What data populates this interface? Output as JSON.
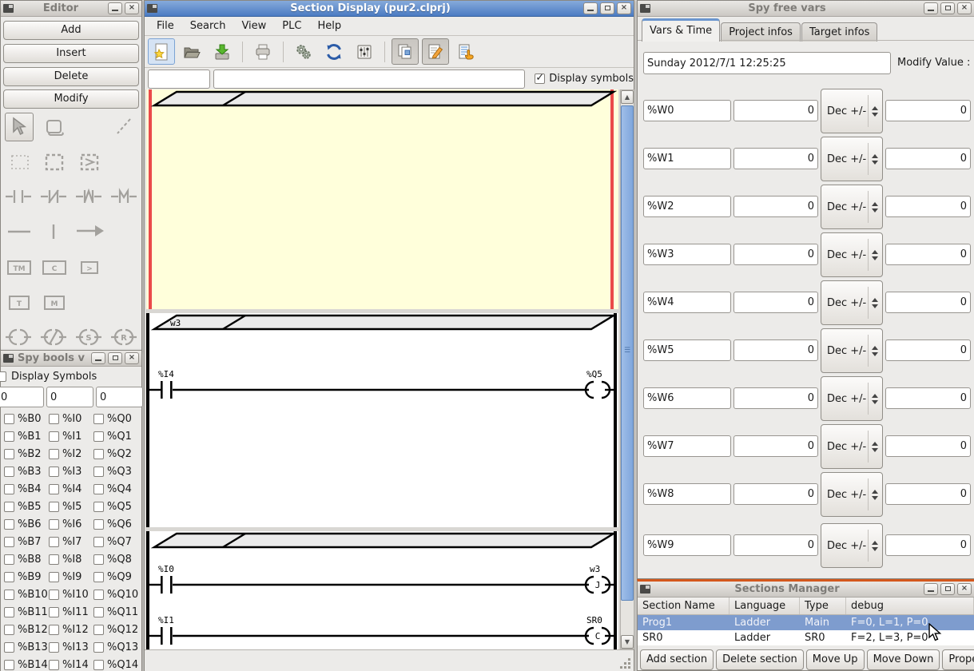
{
  "editor": {
    "title": "Editor",
    "buttons": [
      "Add",
      "Insert",
      "Delete",
      "Modify"
    ],
    "glyphs": {
      "tm": "TM",
      "c": "C",
      "gt": ">",
      "t": "T",
      "m": "M",
      "s": "S",
      "r": "R"
    }
  },
  "section_display": {
    "title": "Section Display (pur2.clprj)",
    "menus": [
      "File",
      "Search",
      "View",
      "PLC",
      "Help"
    ],
    "search_value": "",
    "comment_value": "",
    "display_symbols_label": "Display symbols",
    "ladder": {
      "rung2_label": "w3",
      "net1": {
        "contact": "%I4",
        "coil": "%Q5",
        "coil_letter": ""
      },
      "net2": {
        "contact": "%I0",
        "coil": "w3",
        "coil_letter": "J"
      },
      "net3": {
        "contact": "%I1",
        "coil": "SR0",
        "coil_letter": "C"
      }
    }
  },
  "spy_free_vars": {
    "title": "Spy free vars",
    "tabs": [
      "Vars & Time",
      "Project infos",
      "Target infos"
    ],
    "datetime": "Sunday 2012/7/1 12:25:25",
    "modify_value_label": "Modify Value :",
    "mode_label": "Dec +/-",
    "rows": [
      {
        "name": "%W0",
        "value": "0",
        "modify": "0"
      },
      {
        "name": "%W1",
        "value": "0",
        "modify": "0"
      },
      {
        "name": "%W2",
        "value": "0",
        "modify": "0"
      },
      {
        "name": "%W3",
        "value": "0",
        "modify": "0"
      },
      {
        "name": "%W4",
        "value": "0",
        "modify": "0"
      },
      {
        "name": "%W5",
        "value": "0",
        "modify": "0"
      },
      {
        "name": "%W6",
        "value": "0",
        "modify": "0"
      },
      {
        "name": "%W7",
        "value": "0",
        "modify": "0"
      },
      {
        "name": "%W8",
        "value": "0",
        "modify": "0"
      },
      {
        "name": "%W9",
        "value": "0",
        "modify": "0"
      }
    ]
  },
  "spy_bools": {
    "title": "Spy bools v",
    "display_symbols_label": "Display Symbols",
    "offsets": [
      "0",
      "0",
      "0"
    ],
    "rows": [
      [
        "%B0",
        "%I0",
        "%Q0"
      ],
      [
        "%B1",
        "%I1",
        "%Q1"
      ],
      [
        "%B2",
        "%I2",
        "%Q2"
      ],
      [
        "%B3",
        "%I3",
        "%Q3"
      ],
      [
        "%B4",
        "%I4",
        "%Q4"
      ],
      [
        "%B5",
        "%I5",
        "%Q5"
      ],
      [
        "%B6",
        "%I6",
        "%Q6"
      ],
      [
        "%B7",
        "%I7",
        "%Q7"
      ],
      [
        "%B8",
        "%I8",
        "%Q8"
      ],
      [
        "%B9",
        "%I9",
        "%Q9"
      ],
      [
        "%B10",
        "%I10",
        "%Q10"
      ],
      [
        "%B11",
        "%I11",
        "%Q11"
      ],
      [
        "%B12",
        "%I12",
        "%Q12"
      ],
      [
        "%B13",
        "%I13",
        "%Q13"
      ],
      [
        "%B14",
        "%I14",
        "%Q14"
      ]
    ]
  },
  "sections_manager": {
    "title": "Sections Manager",
    "columns": [
      "Section Name",
      "Language",
      "Type",
      "debug"
    ],
    "rows": [
      {
        "name": "Prog1",
        "language": "Ladder",
        "type": "Main",
        "debug": "F=0, L=1, P=0",
        "selected": true
      },
      {
        "name": "SR0",
        "language": "Ladder",
        "type": "SR0",
        "debug": "F=2, L=3, P=0",
        "selected": false
      }
    ],
    "buttons": [
      "Add section",
      "Delete section",
      "Move Up",
      "Move Down",
      "Properties"
    ]
  },
  "colors": {
    "active_title": "#4B7BC2",
    "selection_blue": "#7E9CCE",
    "rung_selected_bg": "#FFFFDB",
    "rung_selected_rail": "#EA4A4A",
    "window_highlight_orange": "#D4581D",
    "scrollbar_thumb": "#7FA6DC"
  }
}
